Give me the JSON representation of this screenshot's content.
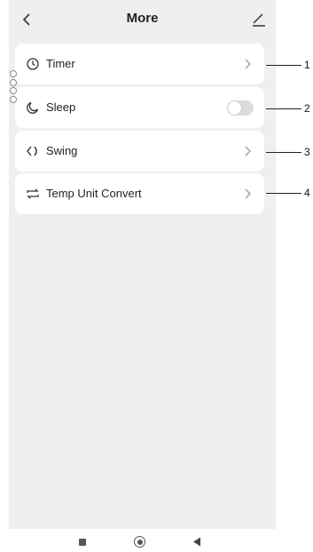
{
  "header": {
    "title": "More",
    "back_icon": "chevron-left-icon",
    "edit_icon": "edit-pencil-icon"
  },
  "items": [
    {
      "label": "Timer",
      "icon": "clock-icon",
      "control": "chevron"
    },
    {
      "label": "Sleep",
      "icon": "moon-icon",
      "control": "toggle",
      "toggle_on": false
    },
    {
      "label": "Swing",
      "icon": "swing-icon",
      "control": "chevron"
    },
    {
      "label": "Temp Unit Convert",
      "icon": "convert-icon",
      "control": "chevron"
    }
  ],
  "callouts": [
    "1",
    "2",
    "3",
    "4"
  ],
  "navbar": {
    "recents_icon": "square-icon",
    "home_icon": "circle-icon",
    "back_icon": "triangle-back-icon"
  },
  "colors": {
    "screen_background": "#efefef",
    "card_background": "#ffffff",
    "toggle_off": "#dcdcdc"
  }
}
